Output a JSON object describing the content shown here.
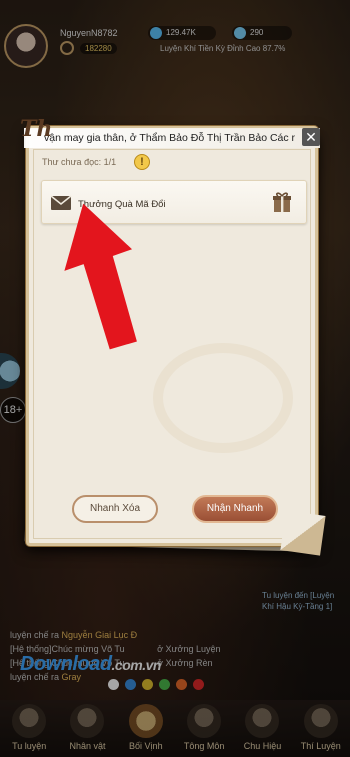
{
  "player": {
    "name": "NguyenN8782",
    "power": "182280"
  },
  "resources": [
    {
      "value": "129.47K",
      "icon": "spirit-stone-icon"
    },
    {
      "value": "290",
      "icon": "jade-icon"
    }
  ],
  "quest_line": "Luyện Khí Tiền Kỳ Đỉnh Cao 87.7%",
  "age_rating": "18+",
  "modal": {
    "banner": "vận may gia thân, ở Thẩm Bảo Đỗ Thị Trần Bảo Các r",
    "banner_letter": "Th",
    "close": "✕",
    "unread_label": "Thư chưa đọc: 1/1",
    "warning_glyph": "!",
    "mail_items": [
      {
        "title": "Thưởng Quà Mã Đổi",
        "icon": "envelope-icon",
        "attachment_icon": "gift-icon"
      }
    ],
    "delete_button": "Nhanh Xóa",
    "receive_button": "Nhận Nhanh"
  },
  "right_panel": {
    "line1": "Tu luyện đến [Luyện",
    "line2": "Khí Hậu Kỳ-Tầng 1]"
  },
  "chat": {
    "line1": "luyện chế ra",
    "line1_hl": "Nguyễn Giai Lục Đ",
    "line2_prefix": "[Hệ thống]Chúc mừng Võ Tu",
    "line2_suffix": "ở Xưởng Luyện",
    "line3_prefix": "[Hệ thống]Chúc mừng Võ Tu",
    "line3_suffix": "ở Xưởng Rèn",
    "line4": "luyện chế ra",
    "line4_hl": "Gray"
  },
  "watermark": {
    "main": "Download",
    "suffix": ".com.vn"
  },
  "color_dots": [
    "#ffffff",
    "#3a8fe0",
    "#e0c030",
    "#4cb84c",
    "#e86a2a",
    "#e02a2a"
  ],
  "bottom_nav": [
    {
      "label": "Tu luyện",
      "icon": "meditation-icon"
    },
    {
      "label": "Nhân vật",
      "icon": "character-icon"
    },
    {
      "label": "Bối Vịnh",
      "icon": "treasure-icon"
    },
    {
      "label": "Tông Môn",
      "icon": "sect-icon"
    },
    {
      "label": "Chu Hiệu",
      "icon": "badge-icon"
    },
    {
      "label": "Thí Luyện",
      "icon": "trial-icon"
    }
  ],
  "colors": {
    "accent_red": "#e3151d",
    "panel_bg": "#efe9dd",
    "receive_button": "#a85a3c"
  }
}
